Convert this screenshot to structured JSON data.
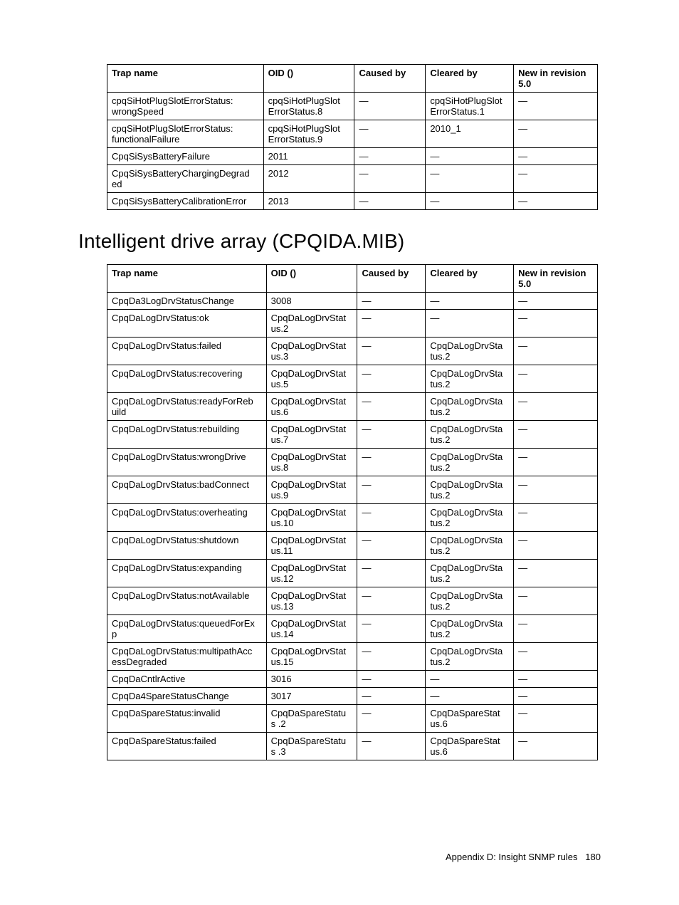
{
  "table1": {
    "headers": [
      "Trap name",
      "OID ()",
      "Caused by",
      "Cleared by",
      "New in revision 5.0"
    ],
    "rows": [
      [
        "cpqSiHotPlugSlotErrorStatus: wrongSpeed",
        "cpqSiHotPlugSlot ErrorStatus.8",
        "—",
        "cpqSiHotPlugSlot ErrorStatus.1",
        "—"
      ],
      [
        "cpqSiHotPlugSlotErrorStatus: functionalFailure",
        "cpqSiHotPlugSlot ErrorStatus.9",
        "—",
        "2010_1",
        "—"
      ],
      [
        "CpqSiSysBatteryFailure",
        "2011",
        "—",
        "—",
        "—"
      ],
      [
        "CpqSiSysBatteryChargingDegrad ed",
        "2012",
        "—",
        "—",
        "—"
      ],
      [
        "CpqSiSysBatteryCalibrationError",
        "2013",
        "—",
        "—",
        "—"
      ]
    ]
  },
  "section_title": "Intelligent drive array (CPQIDA.MIB)",
  "table2": {
    "headers": [
      "Trap name",
      "OID ()",
      "Caused by",
      "Cleared by",
      "New in revision 5.0"
    ],
    "rows": [
      [
        "CpqDa3LogDrvStatusChange",
        "3008",
        "—",
        "—",
        "—"
      ],
      [
        "CpqDaLogDrvStatus:ok",
        "CpqDaLogDrvStat us.2",
        "—",
        "—",
        "—"
      ],
      [
        "CpqDaLogDrvStatus:failed",
        "CpqDaLogDrvStat us.3",
        "—",
        "CpqDaLogDrvSta tus.2",
        "—"
      ],
      [
        "CpqDaLogDrvStatus:recovering",
        "CpqDaLogDrvStat us.5",
        "—",
        "CpqDaLogDrvSta tus.2",
        "—"
      ],
      [
        "CpqDaLogDrvStatus:readyForReb uild",
        "CpqDaLogDrvStat us.6",
        "—",
        "CpqDaLogDrvSta tus.2",
        "—"
      ],
      [
        "CpqDaLogDrvStatus:rebuilding",
        "CpqDaLogDrvStat us.7",
        "—",
        "CpqDaLogDrvSta tus.2",
        "—"
      ],
      [
        "CpqDaLogDrvStatus:wrongDrive",
        "CpqDaLogDrvStat us.8",
        "—",
        "CpqDaLogDrvSta tus.2",
        "—"
      ],
      [
        "CpqDaLogDrvStatus:badConnect",
        "CpqDaLogDrvStat us.9",
        "—",
        "CpqDaLogDrvSta tus.2",
        "—"
      ],
      [
        "CpqDaLogDrvStatus:overheating",
        "CpqDaLogDrvStat us.10",
        "—",
        "CpqDaLogDrvSta tus.2",
        "—"
      ],
      [
        "CpqDaLogDrvStatus:shutdown",
        "CpqDaLogDrvStat us.11",
        "—",
        "CpqDaLogDrvSta tus.2",
        "—"
      ],
      [
        "CpqDaLogDrvStatus:expanding",
        "CpqDaLogDrvStat us.12",
        "—",
        "CpqDaLogDrvSta tus.2",
        "—"
      ],
      [
        "CpqDaLogDrvStatus:notAvailable",
        "CpqDaLogDrvStat us.13",
        "—",
        "CpqDaLogDrvSta tus.2",
        "—"
      ],
      [
        "CpqDaLogDrvStatus:queuedForEx p",
        "CpqDaLogDrvStat us.14",
        "—",
        "CpqDaLogDrvSta tus.2",
        "—"
      ],
      [
        "CpqDaLogDrvStatus:multipathAcc essDegraded",
        "CpqDaLogDrvStat us.15",
        "—",
        "CpqDaLogDrvSta tus.2",
        "—"
      ],
      [
        "CpqDaCntlrActive",
        "3016",
        "—",
        "—",
        "—"
      ],
      [
        "CpqDa4SpareStatusChange",
        "3017",
        "—",
        "—",
        "—"
      ],
      [
        "CpqDaSpareStatus:invalid",
        "CpqDaSpareStatu s .2",
        "—",
        "CpqDaSpareStat us.6",
        "—"
      ],
      [
        "CpqDaSpareStatus:failed",
        "CpqDaSpareStatu s .3",
        "—",
        "CpqDaSpareStat us.6",
        "—"
      ]
    ]
  },
  "footer": {
    "text": "Appendix D: Insight SNMP rules",
    "page": "180"
  }
}
